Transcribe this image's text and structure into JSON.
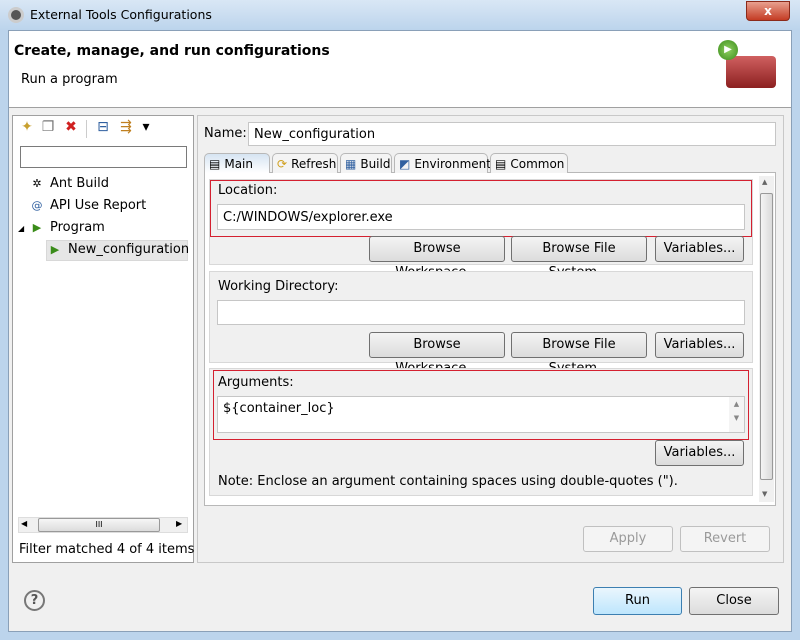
{
  "window": {
    "title": "External Tools Configurations",
    "close_label": "x"
  },
  "header": {
    "title": "Create, manage, and run configurations",
    "subtitle": "Run a program"
  },
  "left": {
    "toolbar": [
      {
        "icon": "new-config-icon",
        "glyph": "✦"
      },
      {
        "icon": "duplicate-icon",
        "glyph": "❐"
      },
      {
        "icon": "delete-icon",
        "glyph": "✖"
      },
      {
        "icon": "collapse-all-icon",
        "glyph": "⊟"
      },
      {
        "icon": "filter-icon",
        "glyph": "⇶"
      },
      {
        "icon": "dropdown-icon",
        "glyph": "▾"
      }
    ],
    "filter_placeholder": "",
    "tree": [
      {
        "label": "Ant Build",
        "glyph": "✲"
      },
      {
        "label": "API Use Report",
        "glyph": "@"
      },
      {
        "label": "Program",
        "glyph": "▶"
      },
      {
        "label": "New_configuration",
        "glyph": "▶"
      }
    ],
    "scroll_grip": "III",
    "status": "Filter matched 4 of 4 items"
  },
  "right": {
    "name_label": "Name:",
    "name_value": "New_configuration",
    "tabs": [
      {
        "label": "Main",
        "glyph": "▤"
      },
      {
        "label": "Refresh",
        "glyph": "⟳"
      },
      {
        "label": "Build",
        "glyph": "▦"
      },
      {
        "label": "Environment",
        "glyph": "◩"
      },
      {
        "label": "Common",
        "glyph": "▤"
      }
    ],
    "location": {
      "label": "Location:",
      "value": "C:/WINDOWS/explorer.exe"
    },
    "working_dir": {
      "label": "Working Directory:",
      "value": ""
    },
    "arguments": {
      "label": "Arguments:",
      "value": "${container_loc}"
    },
    "browse_workspace": "Browse Workspace...",
    "browse_fs": "Browse File System...",
    "variables": "Variables...",
    "note": "Note: Enclose an argument containing spaces using double-quotes (\").",
    "apply": "Apply",
    "revert": "Revert"
  },
  "footer": {
    "help": "?",
    "run": "Run",
    "close": "Close"
  },
  "colors": {
    "highlight_box": "#d42030",
    "accent": "#3c7fb1"
  }
}
